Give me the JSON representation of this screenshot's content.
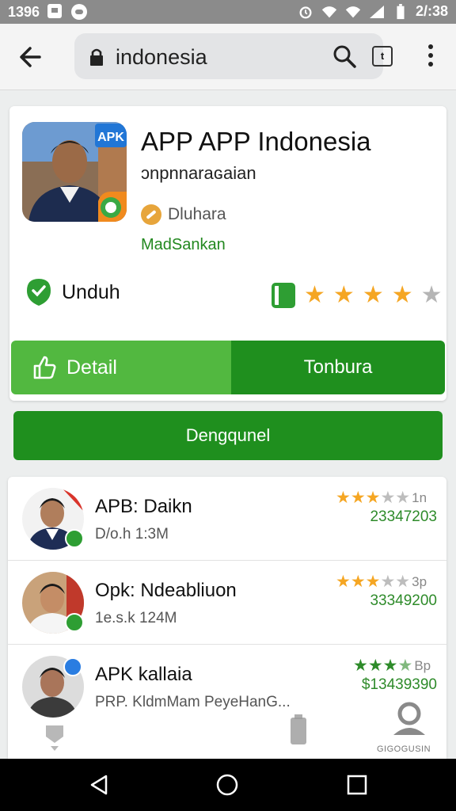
{
  "status_bar": {
    "left_time": "1396",
    "right_time": "2/:38",
    "icons": [
      "notification-square-icon",
      "message-icon",
      "alarm-icon",
      "wifi-icon",
      "wifi-icon",
      "signal-icon",
      "battery-icon"
    ]
  },
  "browser": {
    "url": "indonesia",
    "tab_count": "t",
    "icons": [
      "back-arrow-icon",
      "lock-icon",
      "search-icon",
      "tabs-icon",
      "more-vert-icon"
    ]
  },
  "app": {
    "title": "APP APP Indonesia",
    "subtitle": "ɔnpnnaraɢaian",
    "developer": "Dluhara",
    "category": "MadSankan",
    "icon_badge": "APK",
    "unduh_label": "Unduh",
    "rating_stars": 4,
    "rating_max": 5
  },
  "buttons": {
    "detail": "Detail",
    "tonbura": "Tonbura",
    "download": "Dengqunel"
  },
  "list": [
    {
      "name": "APB: Daikn",
      "meta": "D/o.h 1:3M",
      "stars": 3.5,
      "count": "1n",
      "number": "23347203",
      "star_color": "orange"
    },
    {
      "name": "Opk: Ndeabliuon",
      "meta": "1e.s.k 124M",
      "stars": 3.5,
      "count": "3p",
      "number": "33349200",
      "star_color": "orange"
    },
    {
      "name": "APK kallaia",
      "meta": "PRP. KldmMam PeyeHanG...",
      "stars": 3.5,
      "count": "Bp",
      "number": "$13439390",
      "star_color": "green"
    }
  ],
  "bottom_label": "GIGOGUSIN",
  "colors": {
    "accent_green": "#1f8f1e",
    "light_green": "#52b840",
    "star_orange": "#f5a623",
    "star_green": "#2e8b2a"
  }
}
